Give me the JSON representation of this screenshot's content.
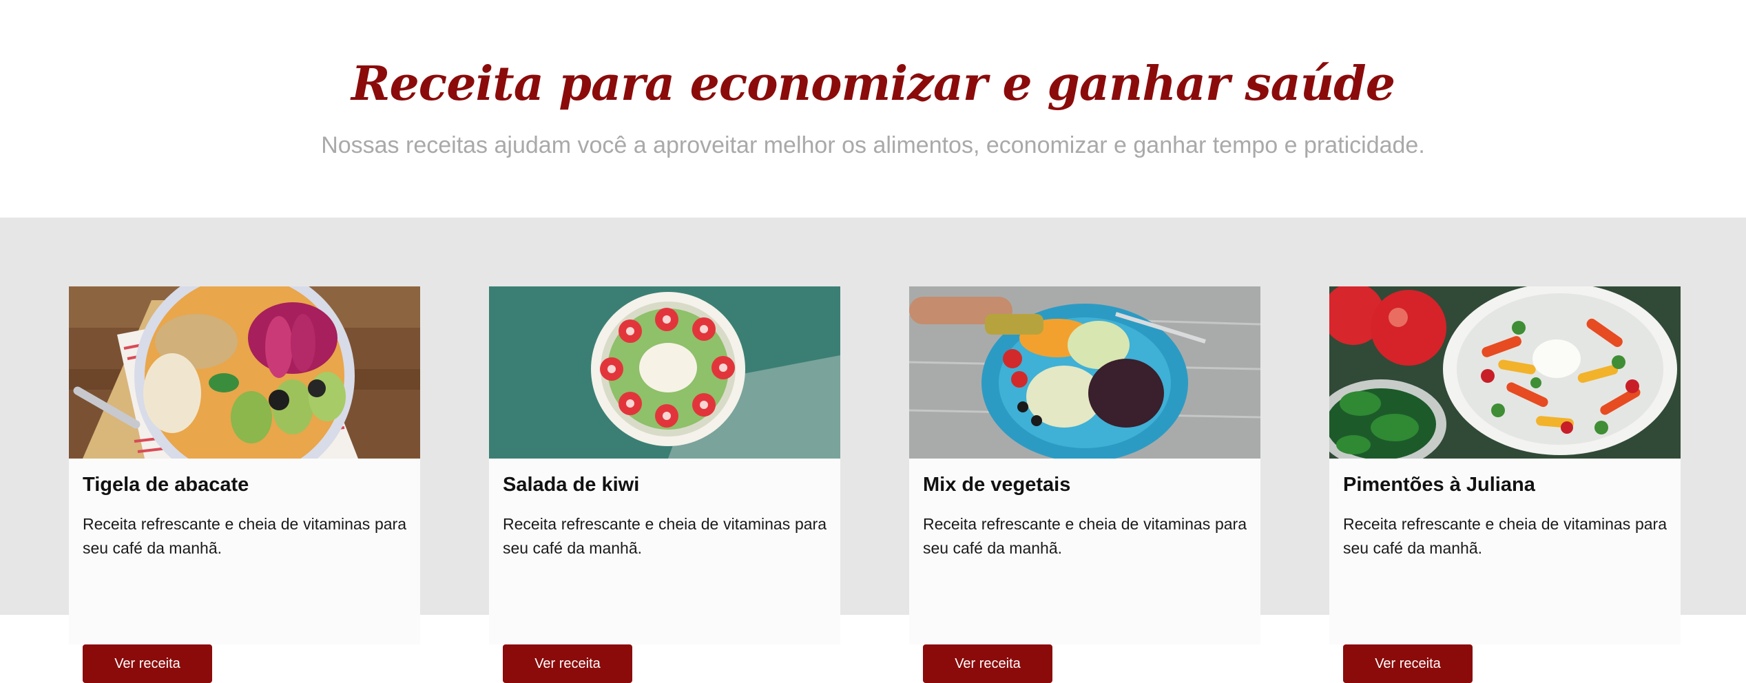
{
  "hero": {
    "title": "Receita para economizar e ganhar saúde",
    "subtitle": "Nossas receitas ajudam você a aproveitar melhor os alimentos, economizar e ganhar tempo e praticidade."
  },
  "colors": {
    "brand": "#8b0b0b",
    "section_background": "#e6e6e6",
    "card_background": "#fbfbfb",
    "subtitle": "#a9a9a9"
  },
  "cards": [
    {
      "title": "Tigela de abacate",
      "text": "Receita refrescante e cheia de vitaminas para seu café da manhã.",
      "button": "Ver receita"
    },
    {
      "title": "Salada de kiwi",
      "text": "Receita refrescante e cheia de vitaminas para seu café da manhã.",
      "button": "Ver receita"
    },
    {
      "title": "Mix de vegetais",
      "text": "Receita refrescante e cheia de vitaminas para seu café da manhã.",
      "button": "Ver receita"
    },
    {
      "title": "Pimentões à Juliana",
      "text": "Receita refrescante e cheia de vitaminas para seu café da manhã.",
      "button": "Ver receita"
    }
  ]
}
